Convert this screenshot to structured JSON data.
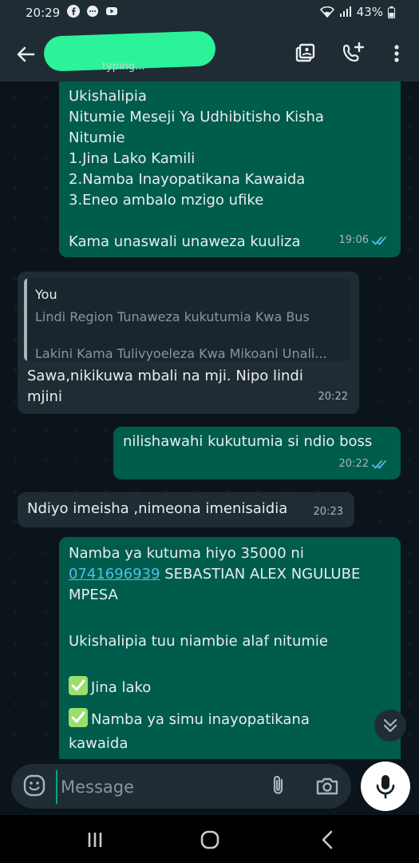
{
  "status_bar": {
    "time": "20:29",
    "battery": "43%"
  },
  "header": {
    "subtitle": "typing..."
  },
  "messages": [
    {
      "type": "outgoing",
      "text": "Ukishalipia\nNitumie Meseji Ya Udhibitisho Kisha\nNitumie\n1.Jina Lako Kamili\n2.Namba Inayopatikana Kawaida\n3.Eneo ambalo mzigo ufike\n\nKama unaswali unaweza kuuliza",
      "time": "19:06"
    },
    {
      "type": "incoming",
      "quote": {
        "author": "You",
        "line1": "Lindi Region Tunaweza kukutumia Kwa Bus",
        "line2": "Lakini Kama Tulivyoeleza Kwa Mikoani Unali..."
      },
      "text": "Sawa,nikikuwa mbali na mji. Nipo lindi\nmjini",
      "time": "20:22"
    },
    {
      "type": "outgoing",
      "text": "nilishawahi kukutumia si ndio boss",
      "time": "20:22"
    },
    {
      "type": "incoming",
      "text": "Ndiyo imeisha ,nimeona imenisaidia",
      "time": "20:23"
    },
    {
      "type": "outgoing",
      "text_before": "Namba ya kutuma hiyo 35000 ni",
      "phone": "0741696939",
      "text_after": " SEBASTIAN ALEX NGULUBE",
      "line3": "MPESA",
      "line4": "Ukishalipia tuu niambie alaf nitumie",
      "check1": "Jina lako",
      "check2": "Namba ya simu inayopatikana",
      "check2b": "kawaida"
    }
  ],
  "composer": {
    "placeholder": "Message"
  },
  "colors": {
    "accent": "#00a884",
    "outgoing_bubble": "#005c4b",
    "incoming_bubble": "#202c33",
    "tick_read": "#53bdeb"
  },
  "icons": [
    "back-arrow-icon",
    "video-call-icon",
    "add-call-icon",
    "more-vert-icon",
    "emoji-icon",
    "attach-icon",
    "camera-icon",
    "mic-icon",
    "scroll-down-icon",
    "recents-icon",
    "home-icon",
    "nav-back-icon"
  ]
}
